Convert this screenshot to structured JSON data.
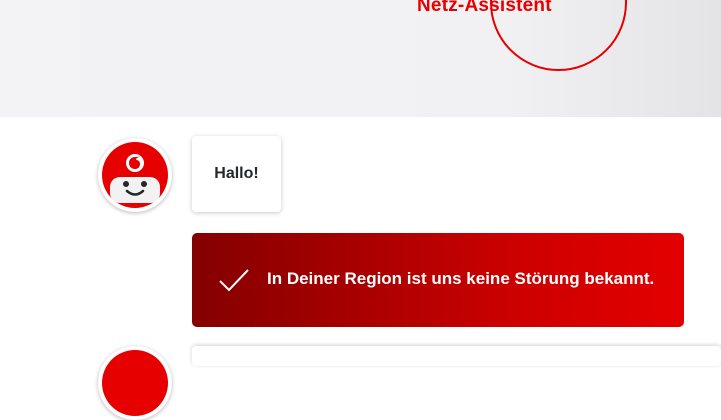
{
  "header": {
    "title": "Netz-Assistent"
  },
  "chat": {
    "greeting": "Hallo!",
    "status_message": "In Deiner Region ist uns keine Störung bekannt.",
    "status_icon": "checkmark-icon",
    "avatar_icon": "vodafone-bot-avatar"
  },
  "colors": {
    "brand_red": "#e60000",
    "card_gradient_start": "#840000",
    "card_gradient_end": "#e30000"
  }
}
